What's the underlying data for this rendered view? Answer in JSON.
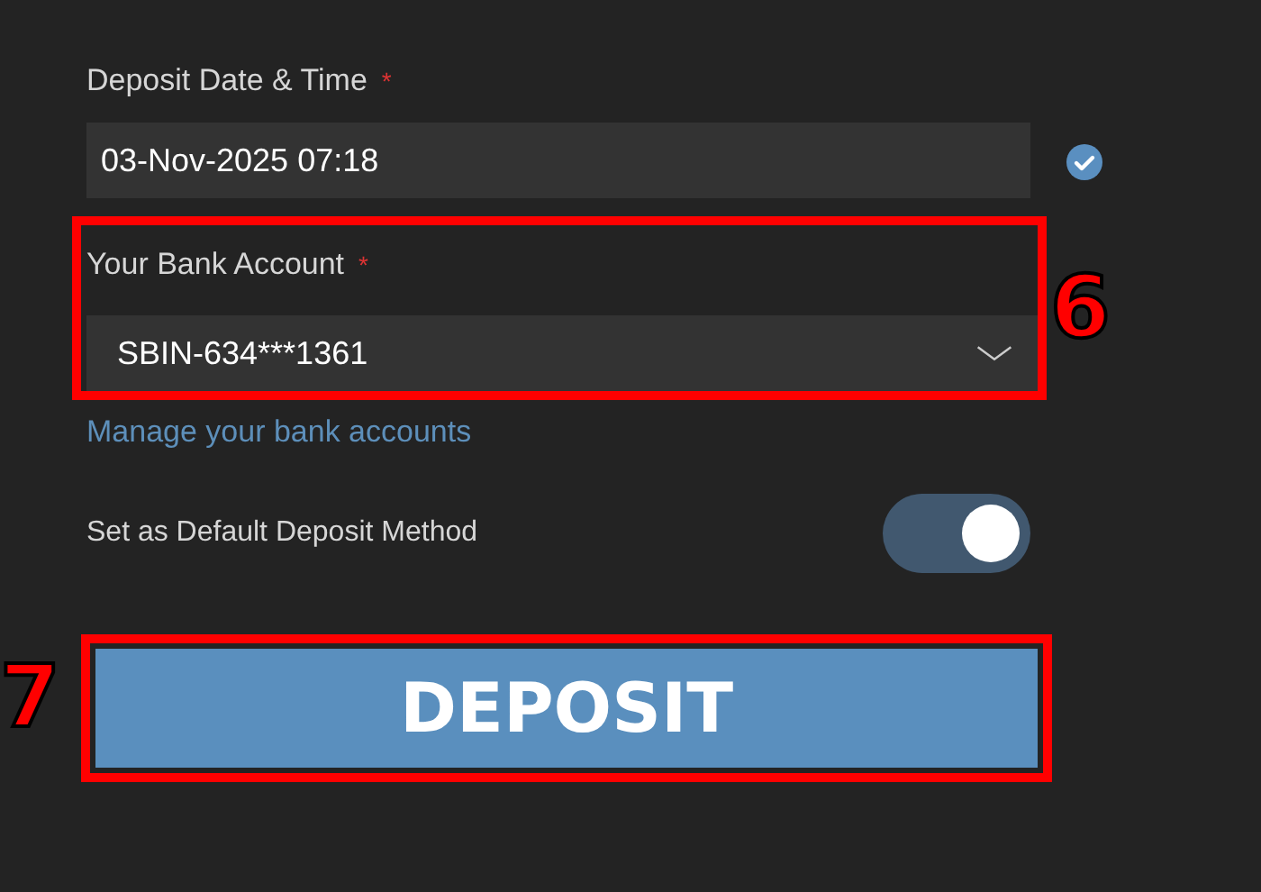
{
  "deposit_date_time": {
    "label": "Deposit Date & Time",
    "required_mark": "*",
    "value": "03-Nov-2025 07:18"
  },
  "bank_account": {
    "label": "Your Bank Account",
    "required_mark": "*",
    "value": "SBIN-634***1361",
    "annotation": "6"
  },
  "manage_link": "Manage your bank accounts",
  "default_method": {
    "label": "Set as Default Deposit Method",
    "on": true
  },
  "deposit_button": {
    "label": "DEPOSIT",
    "annotation": "7"
  }
}
